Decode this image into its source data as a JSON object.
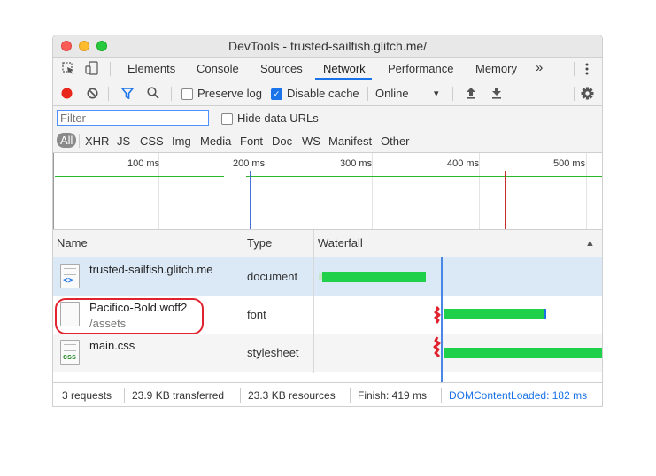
{
  "window": {
    "title": "DevTools - trusted-sailfish.glitch.me/"
  },
  "tabs": [
    {
      "label": "Elements"
    },
    {
      "label": "Console"
    },
    {
      "label": "Sources"
    },
    {
      "label": "Network",
      "active": true
    },
    {
      "label": "Performance"
    },
    {
      "label": "Memory"
    }
  ],
  "more_tabs": "»",
  "toolbar": {
    "preserve_log": "Preserve log",
    "disable_cache": "Disable cache",
    "throttle": "Online",
    "dropdown_arrow": "▾"
  },
  "filter": {
    "placeholder": "Filter",
    "hide_data_urls": "Hide data URLs"
  },
  "types": [
    "All",
    "XHR",
    "JS",
    "CSS",
    "Img",
    "Media",
    "Font",
    "Doc",
    "WS",
    "Manifest",
    "Other"
  ],
  "overview_ticks": [
    "100 ms",
    "200 ms",
    "300 ms",
    "400 ms",
    "500 ms"
  ],
  "columns": {
    "name": "Name",
    "type": "Type",
    "waterfall": "Waterfall",
    "sort": "▲"
  },
  "requests": [
    {
      "name": "trusted-sailfish.glitch.me",
      "sub": "",
      "type": "document",
      "icon": "html-file-icon",
      "badge": "<>"
    },
    {
      "name": "Pacifico-Bold.woff2",
      "sub": "/assets",
      "type": "font",
      "icon": "font-file-icon",
      "badge": ""
    },
    {
      "name": "main.css",
      "sub": "",
      "type": "stylesheet",
      "icon": "css-file-icon",
      "badge": "css"
    }
  ],
  "status": {
    "requests": "3 requests",
    "transferred": "23.9 KB transferred",
    "resources": "23.3 KB resources",
    "finish": "Finish: 419 ms",
    "dom_loaded": "DOMContentLoaded: 182 ms"
  },
  "colors": {
    "accent": "#1a73e8",
    "bar": "#1ed04a",
    "record": "#e8261c",
    "annotation": "#e0232e"
  }
}
